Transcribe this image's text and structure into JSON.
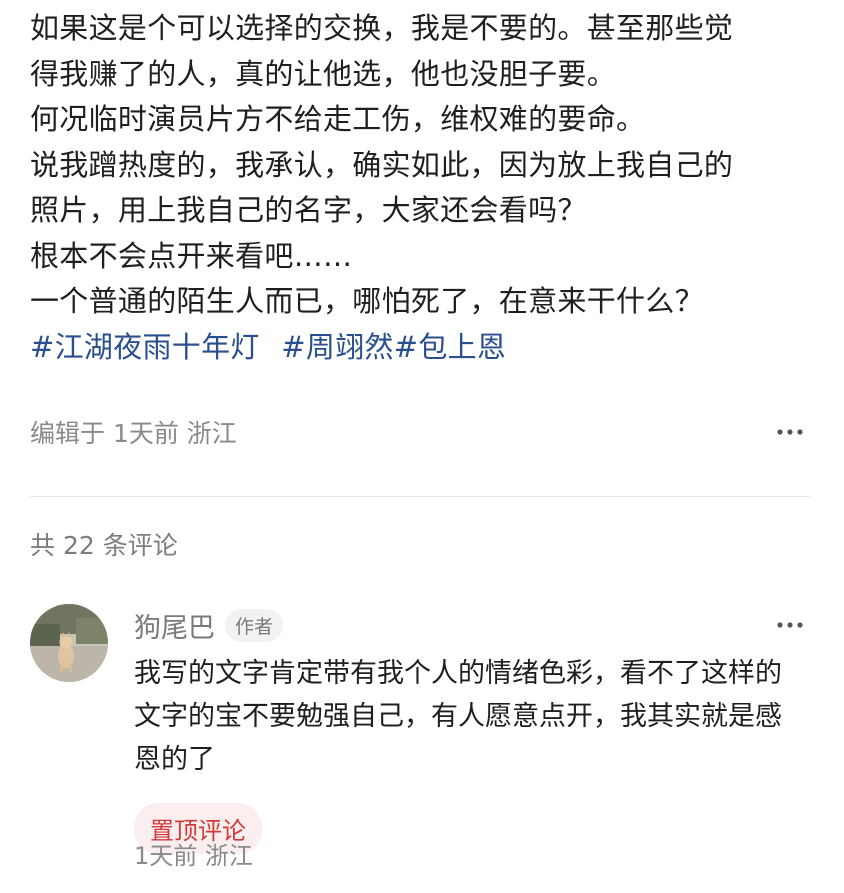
{
  "post": {
    "lines": [
      "如果这是个可以选择的交换，我是不要的。甚至那些觉",
      "得我赚了的人，真的让他选，他也没胆子要。",
      "何况临时演员片方不给走工伤，维权难的要命。",
      "说我蹭热度的，我承认，确实如此，因为放上我自己的",
      "照片，用上我自己的名字，大家还会看吗？",
      "根本不会点开来看吧……",
      "一个普通的陌生人而已，哪怕死了，在意来干什么？"
    ],
    "hashtags": [
      "#江湖夜雨十年灯",
      "#周翊然",
      "#包上恩"
    ],
    "meta": "编辑于 1天前 浙江",
    "more_icon": "ellipsis-icon"
  },
  "comments_section": {
    "count_label": "共 22 条评论",
    "comments": [
      {
        "author": "狗尾巴",
        "badge": "作者",
        "avatar_icon": "dog-photo-avatar",
        "text_lines": [
          "我写的文字肯定带有我个人的情绪色彩，看不了这样的",
          "文字的宝不要勉强自己，有人愿意点开，我其实就是感",
          "恩的了"
        ],
        "pin_label": "置顶评论",
        "time": "1天前 浙江"
      }
    ]
  },
  "colors": {
    "hashtag": "#2a4f8f",
    "pin_text": "#d23a3a",
    "pin_bg": "#fbeeee",
    "muted": "#8a8a8a"
  }
}
